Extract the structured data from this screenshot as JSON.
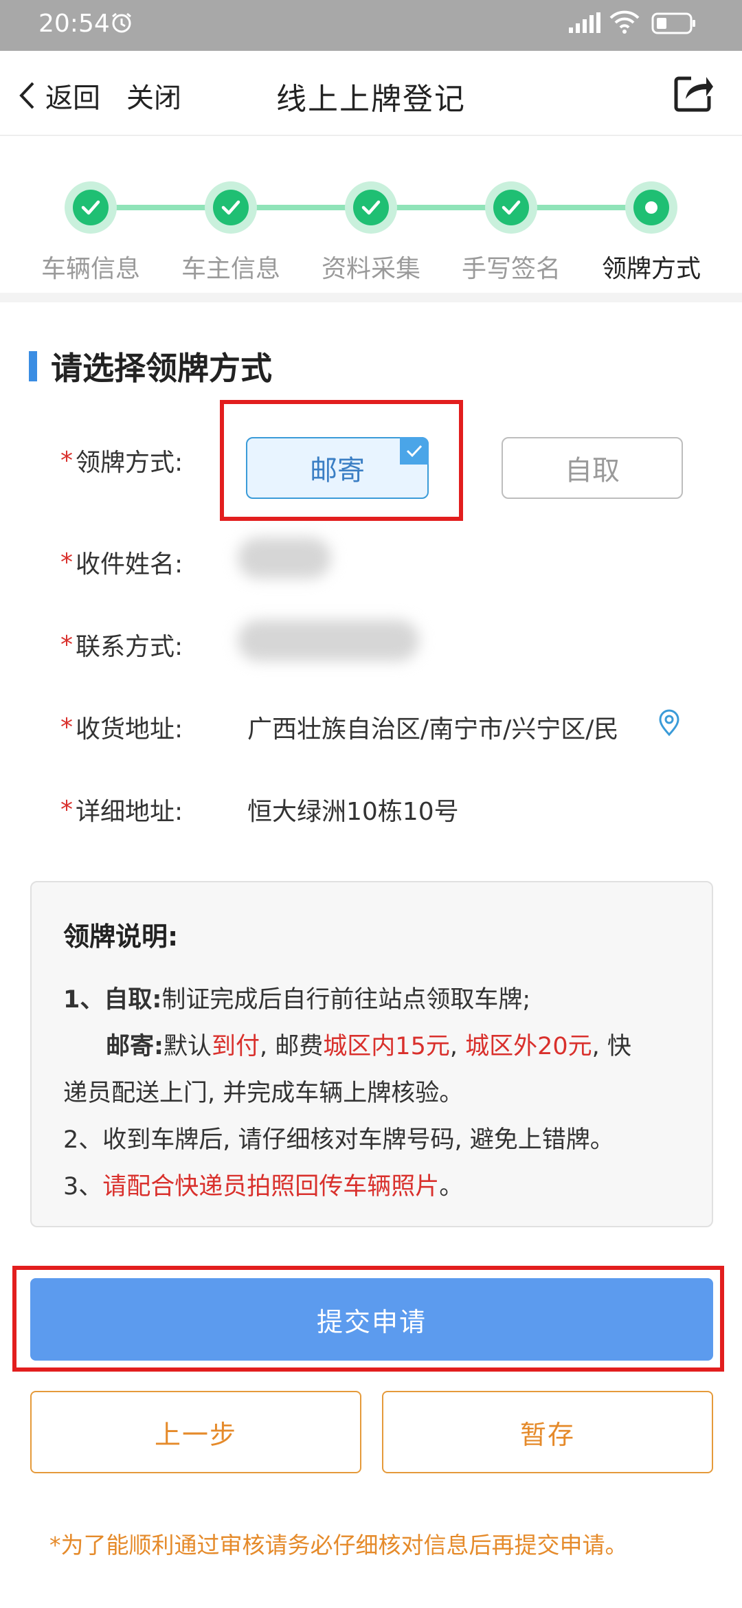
{
  "status_bar": {
    "time": "20:54"
  },
  "nav": {
    "back_label": "返回",
    "close_label": "关闭",
    "title": "线上上牌登记"
  },
  "steps": [
    {
      "label": "车辆信息",
      "state": "done"
    },
    {
      "label": "车主信息",
      "state": "done"
    },
    {
      "label": "资料采集",
      "state": "done"
    },
    {
      "label": "手写签名",
      "state": "done"
    },
    {
      "label": "领牌方式",
      "state": "current"
    }
  ],
  "section_title": "请选择领牌方式",
  "form": {
    "method_label": "领牌方式:",
    "method_options": {
      "mail": "邮寄",
      "self": "自取",
      "selected": "邮寄"
    },
    "name_label": "收件姓名:",
    "contact_label": "联系方式:",
    "address_label": "收货地址:",
    "address_value": "广西壮族自治区/南宁市/兴宁区/民",
    "detail_label": "详细地址:",
    "detail_value": "恒大绿洲10栋10号"
  },
  "notice": {
    "title": "领牌说明:",
    "l1_head": "1、自取:",
    "l1_text": "制证完成后自行前往站点领取车牌;",
    "l2_head": "邮寄:",
    "l2_a": "默认",
    "l2_b": "到付",
    "l2_c": ", 邮费",
    "l2_d": "城区内15元",
    "l2_e": ", ",
    "l2_f": "城区外20元",
    "l2_g": ", 快",
    "l3": "递员配送上门, 并完成车辆上牌核验。",
    "l4": "2、收到车牌后, 请仔细核对车牌号码, 避免上错牌。",
    "l5_head": "3、",
    "l5_red": "请配合快递员拍照回传车辆照片",
    "l5_tail": "。"
  },
  "buttons": {
    "submit": "提交申请",
    "prev": "上一步",
    "save": "暂存"
  },
  "footnote": "*为了能顺利通过审核请务必仔细核对信息后再提交申请。",
  "colors": {
    "accent_green": "#1fbf73",
    "submit_blue": "#5c9bee",
    "orange": "#e58a2a",
    "required_red": "#d9302c",
    "highlight_red": "#e21e1e"
  }
}
